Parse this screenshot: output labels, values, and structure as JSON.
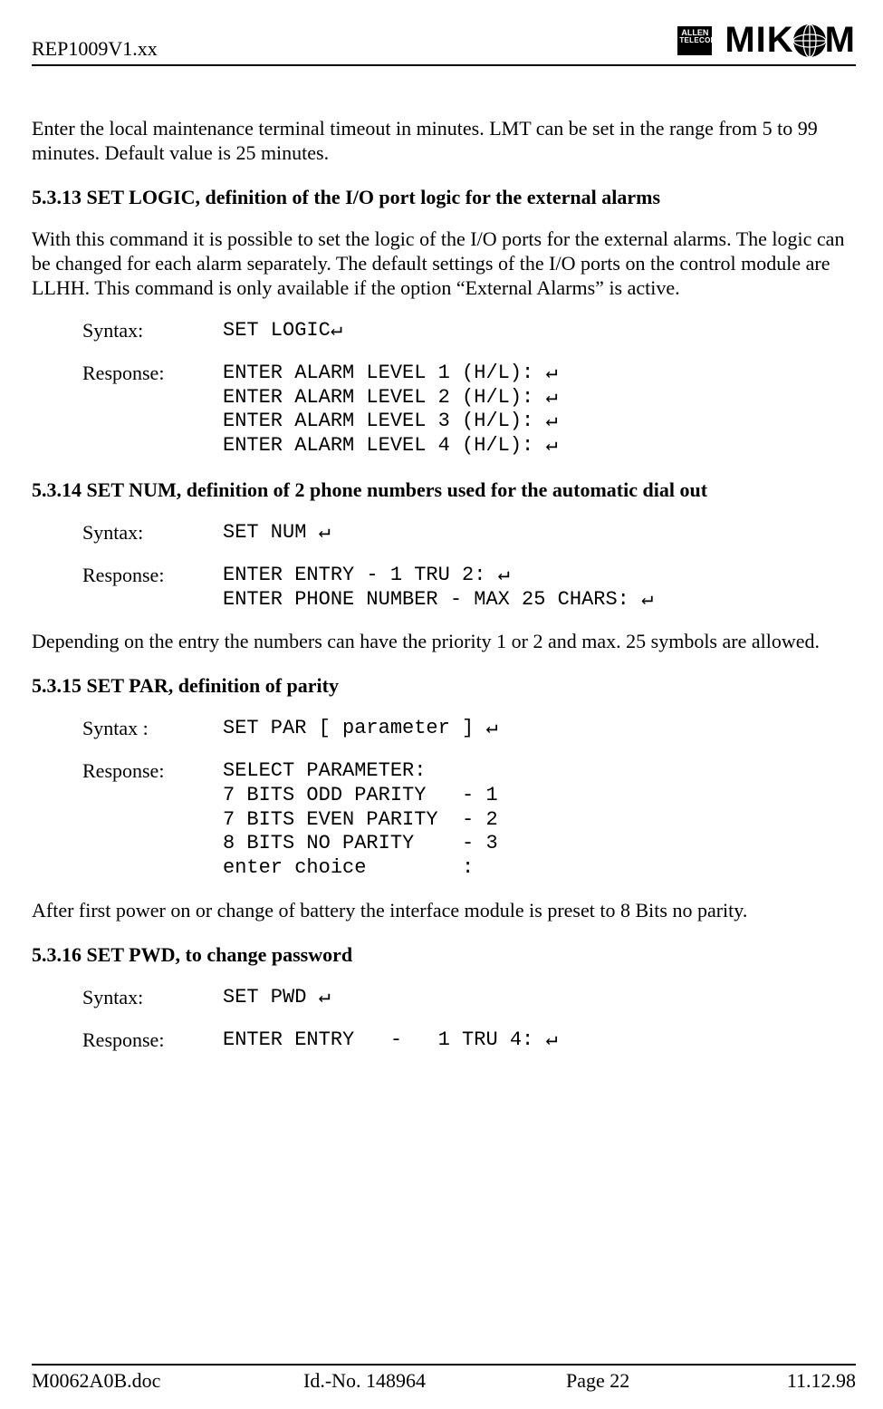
{
  "header": {
    "doc_ref": "REP1009V1.xx",
    "logo_allen_line1": "ALLEN",
    "logo_allen_line2": "TELECOM",
    "logo_mikom_left": "MIK",
    "logo_mikom_right": "M"
  },
  "body": {
    "p_intro": "Enter the local maintenance terminal timeout in minutes. LMT can be set in the range from 5 to 99 minutes. Default value is 25 minutes.",
    "s13_heading": "5.3.13  SET LOGIC, definition of the I/O port logic for the external alarms",
    "s13_para": "With this command it is possible to set the logic of the I/O ports for the external alarms. The logic can be changed for each alarm separately. The default settings of the I/O ports on the control module are LLHH. This command is only available if the option “External Alarms” is active.",
    "label_syntax": "Syntax:",
    "label_syntax_sp": "Syntax :",
    "label_response": "Response:",
    "s13_syntax": "SET LOGIC↵",
    "s13_resp": "ENTER ALARM LEVEL 1 (H/L): ↵\nENTER ALARM LEVEL 2 (H/L): ↵\nENTER ALARM LEVEL 3 (H/L): ↵\nENTER ALARM LEVEL 4 (H/L): ↵",
    "s14_heading": "5.3.14  SET NUM, definition of 2 phone numbers used for the automatic dial out",
    "s14_syntax": "SET NUM ↵",
    "s14_resp": "ENTER ENTRY - 1 TRU 2: ↵\nENTER PHONE NUMBER - MAX 25 CHARS: ↵",
    "s14_para": "Depending on the entry the numbers can have the priority 1 or 2 and  max. 25 symbols are allowed.",
    "s15_heading": "5.3.15  SET PAR, definition of parity",
    "s15_syntax": "SET PAR [ parameter ] ↵",
    "s15_resp": "SELECT PARAMETER:\n7 BITS ODD PARITY   - 1\n7 BITS EVEN PARITY  - 2\n8 BITS NO PARITY    - 3\nenter choice        :",
    "s15_para": "After first power on or change of battery the interface module is preset to 8 Bits no parity.",
    "s16_heading": "5.3.16  SET PWD, to change password",
    "s16_syntax": "SET PWD ↵",
    "s16_resp": "ENTER ENTRY   -   1 TRU 4: ↵"
  },
  "footer": {
    "file": "M0062A0B.doc",
    "id": "Id.-No. 148964",
    "page": "Page 22",
    "date": "11.12.98"
  }
}
